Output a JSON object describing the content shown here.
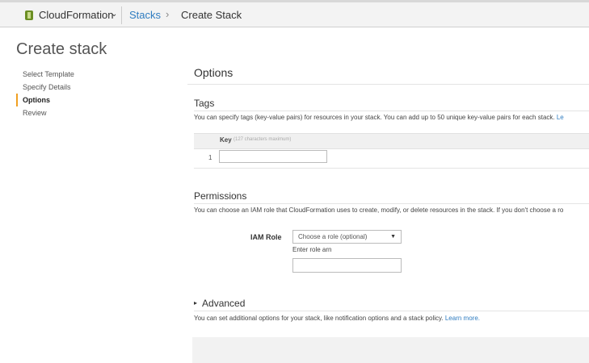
{
  "topbar": {
    "service_name": "CloudFormation",
    "service_caret": "⌄",
    "breadcrumb_link": "Stacks",
    "breadcrumb_separator": "›",
    "breadcrumb_current": "Create Stack",
    "logo_color": "#6b8e23"
  },
  "page": {
    "title": "Create stack"
  },
  "sidebar": {
    "items": [
      {
        "label": "Select Template",
        "active": false
      },
      {
        "label": "Specify Details",
        "active": false
      },
      {
        "label": "Options",
        "active": true
      },
      {
        "label": "Review",
        "active": false
      }
    ]
  },
  "options": {
    "title": "Options"
  },
  "tags": {
    "title": "Tags",
    "description": "You can specify tags (key-value pairs) for resources in your stack. You can add up to 50 unique key-value pairs for each stack.",
    "description_link": "Le",
    "key_header": "Key",
    "key_hint": "(127 characters maximum)",
    "rows": [
      {
        "number": "1",
        "key": ""
      }
    ]
  },
  "permissions": {
    "title": "Permissions",
    "description": "You can choose an IAM role that CloudFormation uses to create, modify, or delete resources in the stack. If you don't choose a ro",
    "iam_label": "IAM Role",
    "iam_select_value": "Choose a role (optional)",
    "iam_select_caret": "▼",
    "arn_label": "Enter role arn",
    "arn_value": ""
  },
  "advanced": {
    "arrow": "▸",
    "title": "Advanced",
    "description": "You can set additional options for your stack, like notification options and a stack policy.",
    "learn_more": "Learn more."
  },
  "colors": {
    "link": "#2f7cc0",
    "active_marker": "#f0a022"
  }
}
